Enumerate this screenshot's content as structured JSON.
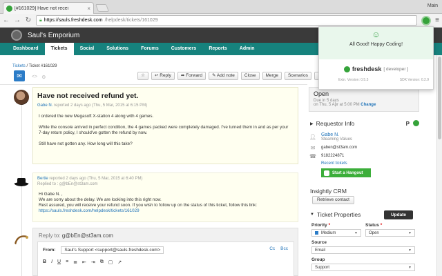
{
  "browser": {
    "tab_title": "[#161029] Have not recei",
    "tab_close": "×",
    "profile": "Main",
    "url_host": "https://sauls.freshdesk.com",
    "url_path": "/helpdesk/tickets/161029",
    "menu_icon": "≡"
  },
  "app": {
    "name": "Saul's Emporium"
  },
  "nav": {
    "items": [
      {
        "label": "Dashboard"
      },
      {
        "label": "Tickets"
      },
      {
        "label": "Social"
      },
      {
        "label": "Solutions"
      },
      {
        "label": "Forums"
      },
      {
        "label": "Customers"
      },
      {
        "label": "Reports"
      },
      {
        "label": "Admin"
      }
    ]
  },
  "breadcrumb": {
    "parent": "Tickets",
    "current": "/ Ticket #161029"
  },
  "toolbar": {
    "star": "☆",
    "reply": "↩ Reply",
    "forward": "➦ Forward",
    "add_note": "✎ Add note",
    "close": "Close",
    "merge": "Merge",
    "scenarios": "Scenarios"
  },
  "ticket": {
    "subject": "Have not received refund yet.",
    "author": "Gabe N.",
    "meta": "reported 2 days ago (Thu, 5 Mar, 2015 at 6:15 PM)",
    "body": [
      "I ordered the new Megasoft X-station 4 along with 4 games.",
      "While the console arrived in perfect condition, the 4 games packed were completely damaged. I've turned them in and as per your 7-day return policy, I should've gotten the refund by now.",
      "Still have not gotten any. How long will this take?"
    ]
  },
  "reply_msg": {
    "author": "Bertie",
    "meta": "reported 2 days ago (Thu, 5 Mar, 2015 at 6:40 PM)",
    "replied_to": "Replied to : g@bEn@st3am.com",
    "greeting": "Hi Gabe N. ,",
    "line1": "We are sorry about the delay. We are looking into this right now.",
    "line2": "Rest assured, you will receive your refund soon. If you wish to follow up on the status of this ticket, follow this link:",
    "link": "https://sauls.freshdesk.com/helpdesk/tickets/161029"
  },
  "reply_box": {
    "reply_to_label": "Reply to:",
    "reply_to_email": "g@bEn@st3am.com",
    "from_label": "From:",
    "from_value": "Saul's Support <support@sauls.freshdesk.com>",
    "cc": "Cc",
    "bcc": "Bcc",
    "tools": [
      "B",
      "I",
      "U",
      "≡",
      "≣",
      "⇤",
      "⇥",
      "⧉",
      "▢",
      "↗"
    ]
  },
  "status": {
    "label": "Open",
    "due": "Due in 5 days",
    "due_date": "on Thu, 5 Apr at 5:00 PM",
    "change": "Change"
  },
  "requester": {
    "heading": "Requestor Info",
    "name": "Gabe N.",
    "company": "Steaming Values",
    "email": "gaben@st3am.com",
    "phone": "9182224871",
    "recent": "Recent tickets",
    "hangout": "Start a Hangout",
    "p_badge": "P"
  },
  "crm": {
    "heading": "Insightly CRM",
    "button": "Retrieve contact"
  },
  "properties": {
    "heading": "Ticket Properties",
    "update": "Update",
    "priority_label": "Priority",
    "priority_value": "Medium",
    "status_label": "Status",
    "status_value": "Open",
    "source_label": "Source",
    "source_value": "Email",
    "group_label": "Group",
    "group_value": "Support",
    "required_mark": "*"
  },
  "popup": {
    "smile": "☺",
    "message": "All Good! Happy Coding!",
    "brand": "freshdesk",
    "brand_suffix": "[ developer ]",
    "ext_version": "Extn. Version: 0.5.3",
    "sdk_version": "SDK Version: 0.2.9"
  }
}
